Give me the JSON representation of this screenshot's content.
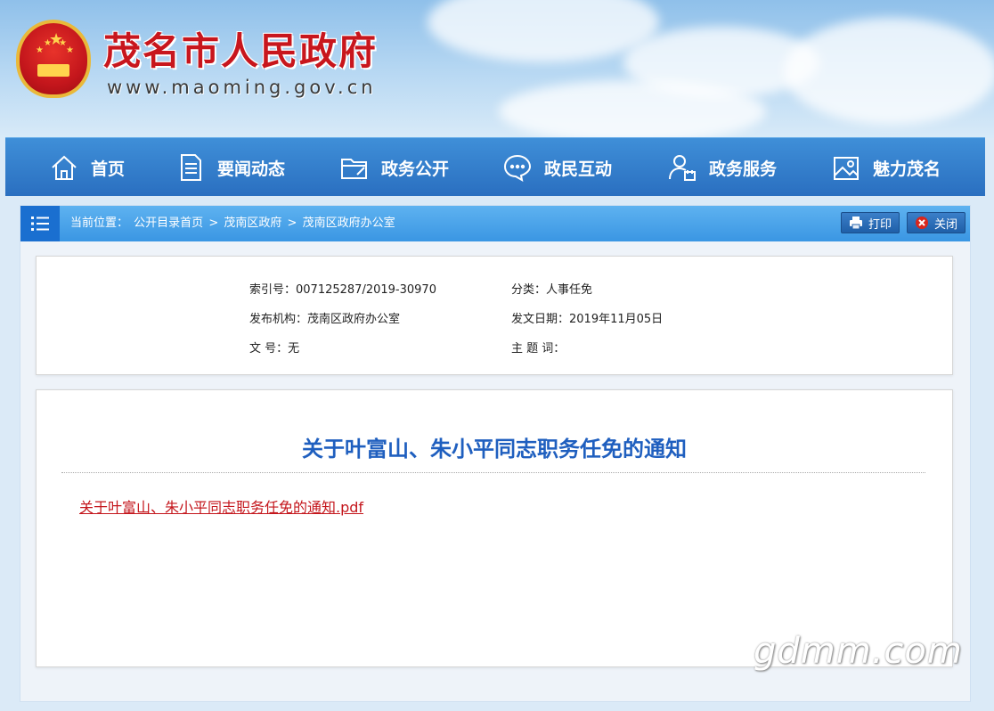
{
  "header": {
    "site_title": "茂名市人民政府",
    "site_url": "www.maoming.gov.cn"
  },
  "nav": {
    "items": [
      {
        "label": "首页",
        "icon": "home-icon"
      },
      {
        "label": "要闻动态",
        "icon": "document-icon"
      },
      {
        "label": "政务公开",
        "icon": "folder-icon"
      },
      {
        "label": "政民互动",
        "icon": "chat-icon"
      },
      {
        "label": "政务服务",
        "icon": "user-calendar-icon"
      },
      {
        "label": "魅力茂名",
        "icon": "picture-icon"
      }
    ]
  },
  "breadcrumb": {
    "prefix": "当前位置：",
    "items": [
      "公开目录首页",
      "茂南区政府",
      "茂南区政府办公室"
    ],
    "separator": ">"
  },
  "toolbar": {
    "print_label": "打印",
    "close_label": "关闭"
  },
  "meta": {
    "index_label": "索引号：",
    "index_value": "007125287/2019-30970",
    "category_label": "分类：",
    "category_value": "人事任免",
    "publisher_label": "发布机构：",
    "publisher_value": "茂南区政府办公室",
    "date_label": "发文日期：",
    "date_value": "2019年11月05日",
    "docno_label": "文 号：",
    "docno_value": "无",
    "keywords_label": "主 题 词：",
    "keywords_value": ""
  },
  "article": {
    "title": "关于叶富山、朱小平同志职务任免的通知",
    "attachment": "关于叶富山、朱小平同志职务任免的通知.pdf"
  },
  "watermark": "gdmm.com",
  "colors": {
    "nav_bg": "#2a6fc0",
    "title_red": "#c8161d",
    "article_title": "#1f5fbf",
    "link_red": "#c4161c"
  }
}
